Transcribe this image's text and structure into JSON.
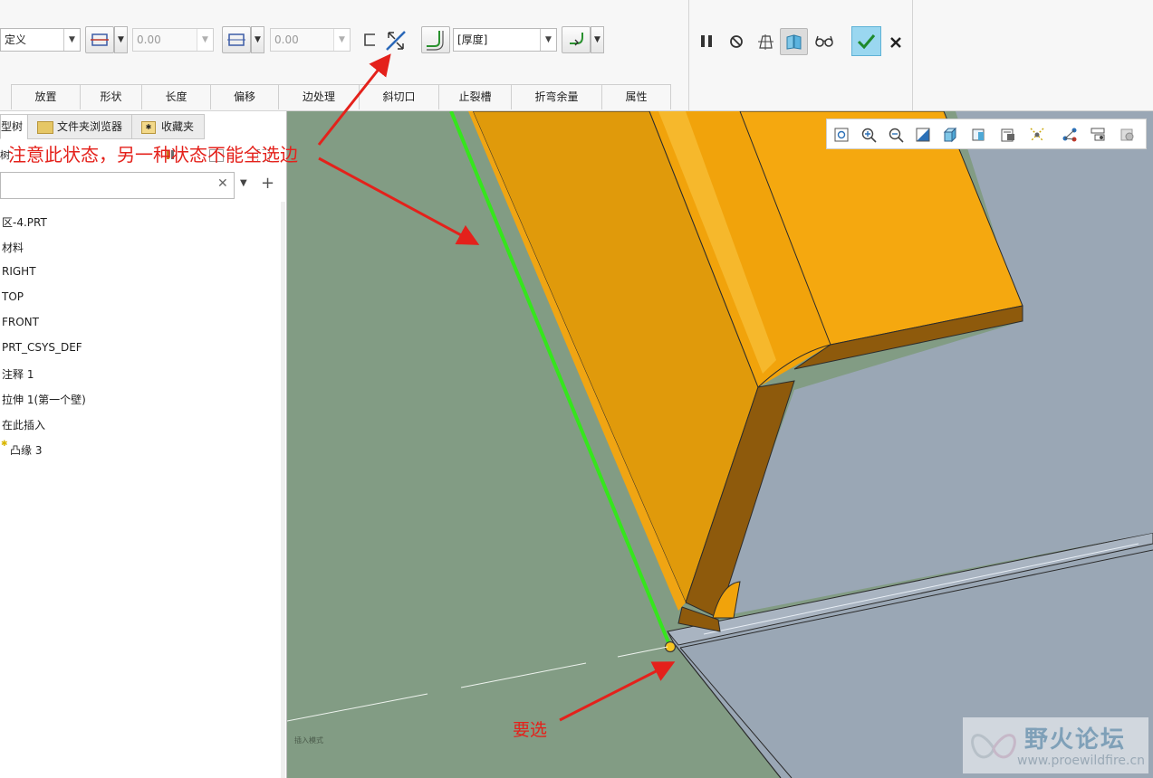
{
  "ribbon": {
    "placement_combo": "定义",
    "offset_value_1": "0.00",
    "offset_value_2": "0.00",
    "thickness_combo": "[厚度]",
    "tabs": [
      "放置",
      "形状",
      "长度",
      "偏移",
      "边处理",
      "斜切口",
      "止裂槽",
      "折弯余量",
      "属性"
    ],
    "icons": {
      "width_type_1": "width-type-icon",
      "width_type_2": "width-type-icon",
      "side": "flange-side-icon",
      "flip": "flip-direction-icon",
      "bend": "bend-edge-icon",
      "bend_radius": "bend-radius-icon",
      "pause": "pause-icon",
      "no_preview": "no-preview-icon",
      "preview": "geometry-preview-icon",
      "verify": "verify-icon",
      "glasses": "glasses-icon",
      "ok": "checkmark-icon",
      "cancel": "close-icon"
    }
  },
  "panel": {
    "tabs": [
      "型树",
      "文件夹浏览器",
      "收藏夹"
    ],
    "filter_label": "树",
    "tree_items": [
      "区-4.PRT",
      "材料",
      "RIGHT",
      "TOP",
      "FRONT",
      "PRT_CSYS_DEF",
      "注释 1",
      "拉伸 1(第一个壁)",
      "在此插入",
      "凸缘 3"
    ]
  },
  "viewport": {
    "toolbar_icons": [
      "refit-icon",
      "zoom-in-icon",
      "zoom-out-icon",
      "repaint-icon",
      "display-style-icon",
      "saved-views-icon",
      "view-manager-icon",
      "datum-display-icon",
      "spin-center-icon",
      "annotation-display-icon",
      "appearance-icon"
    ],
    "annotation_top": "注意此状态，另一种状态不能全选边",
    "annotation_bottom": "要选",
    "small_label": "插入模式"
  },
  "watermark": {
    "brand": "野火论坛",
    "url": "www.proewildfire.cn"
  },
  "colors": {
    "annotation": "#e4211b",
    "viewport_bg": "#829c84",
    "flange_orange": "#f5a20f",
    "selected_edge": "#35e61c",
    "wall_gray": "#9aa7b5",
    "ok_button": "#9ad7f0"
  }
}
